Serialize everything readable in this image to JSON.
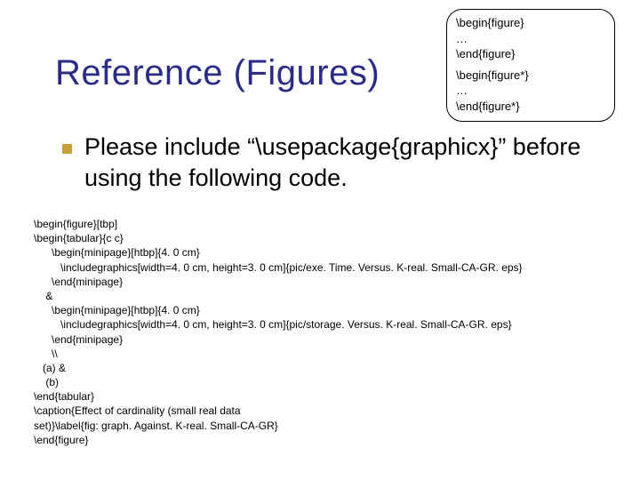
{
  "slide": {
    "title": "Reference (Figures)"
  },
  "callout": {
    "line1": "\\begin{figure}",
    "line2": "…",
    "line3": "\\end{figure}",
    "line4": "\\begin{figure*}",
    "line5": "…",
    "line6": "\\end{figure*}"
  },
  "body": {
    "text": "Please include “\\usepackage{graphicx}” before using the following code."
  },
  "code": {
    "content": "\\begin{figure}[tbp]\n\\begin{tabular}{c c}\n      \\begin{minipage}[htbp]{4. 0 cm}\n         \\includegraphics[width=4. 0 cm, height=3. 0 cm]{pic/exe. Time. Versus. K-real. Small-CA-GR. eps}\n      \\end{minipage}\n    &\n      \\begin{minipage}[htbp]{4. 0 cm}\n         \\includegraphics[width=4. 0 cm, height=3. 0 cm]{pic/storage. Versus. K-real. Small-CA-GR. eps}\n      \\end{minipage}\n      \\\\\n   (a) &\n    (b)\n\\end{tabular}\n\\caption{Effect of cardinality (small real data\nset)}\\label{fig: graph. Against. K-real. Small-CA-GR}\n\\end{figure}"
  }
}
